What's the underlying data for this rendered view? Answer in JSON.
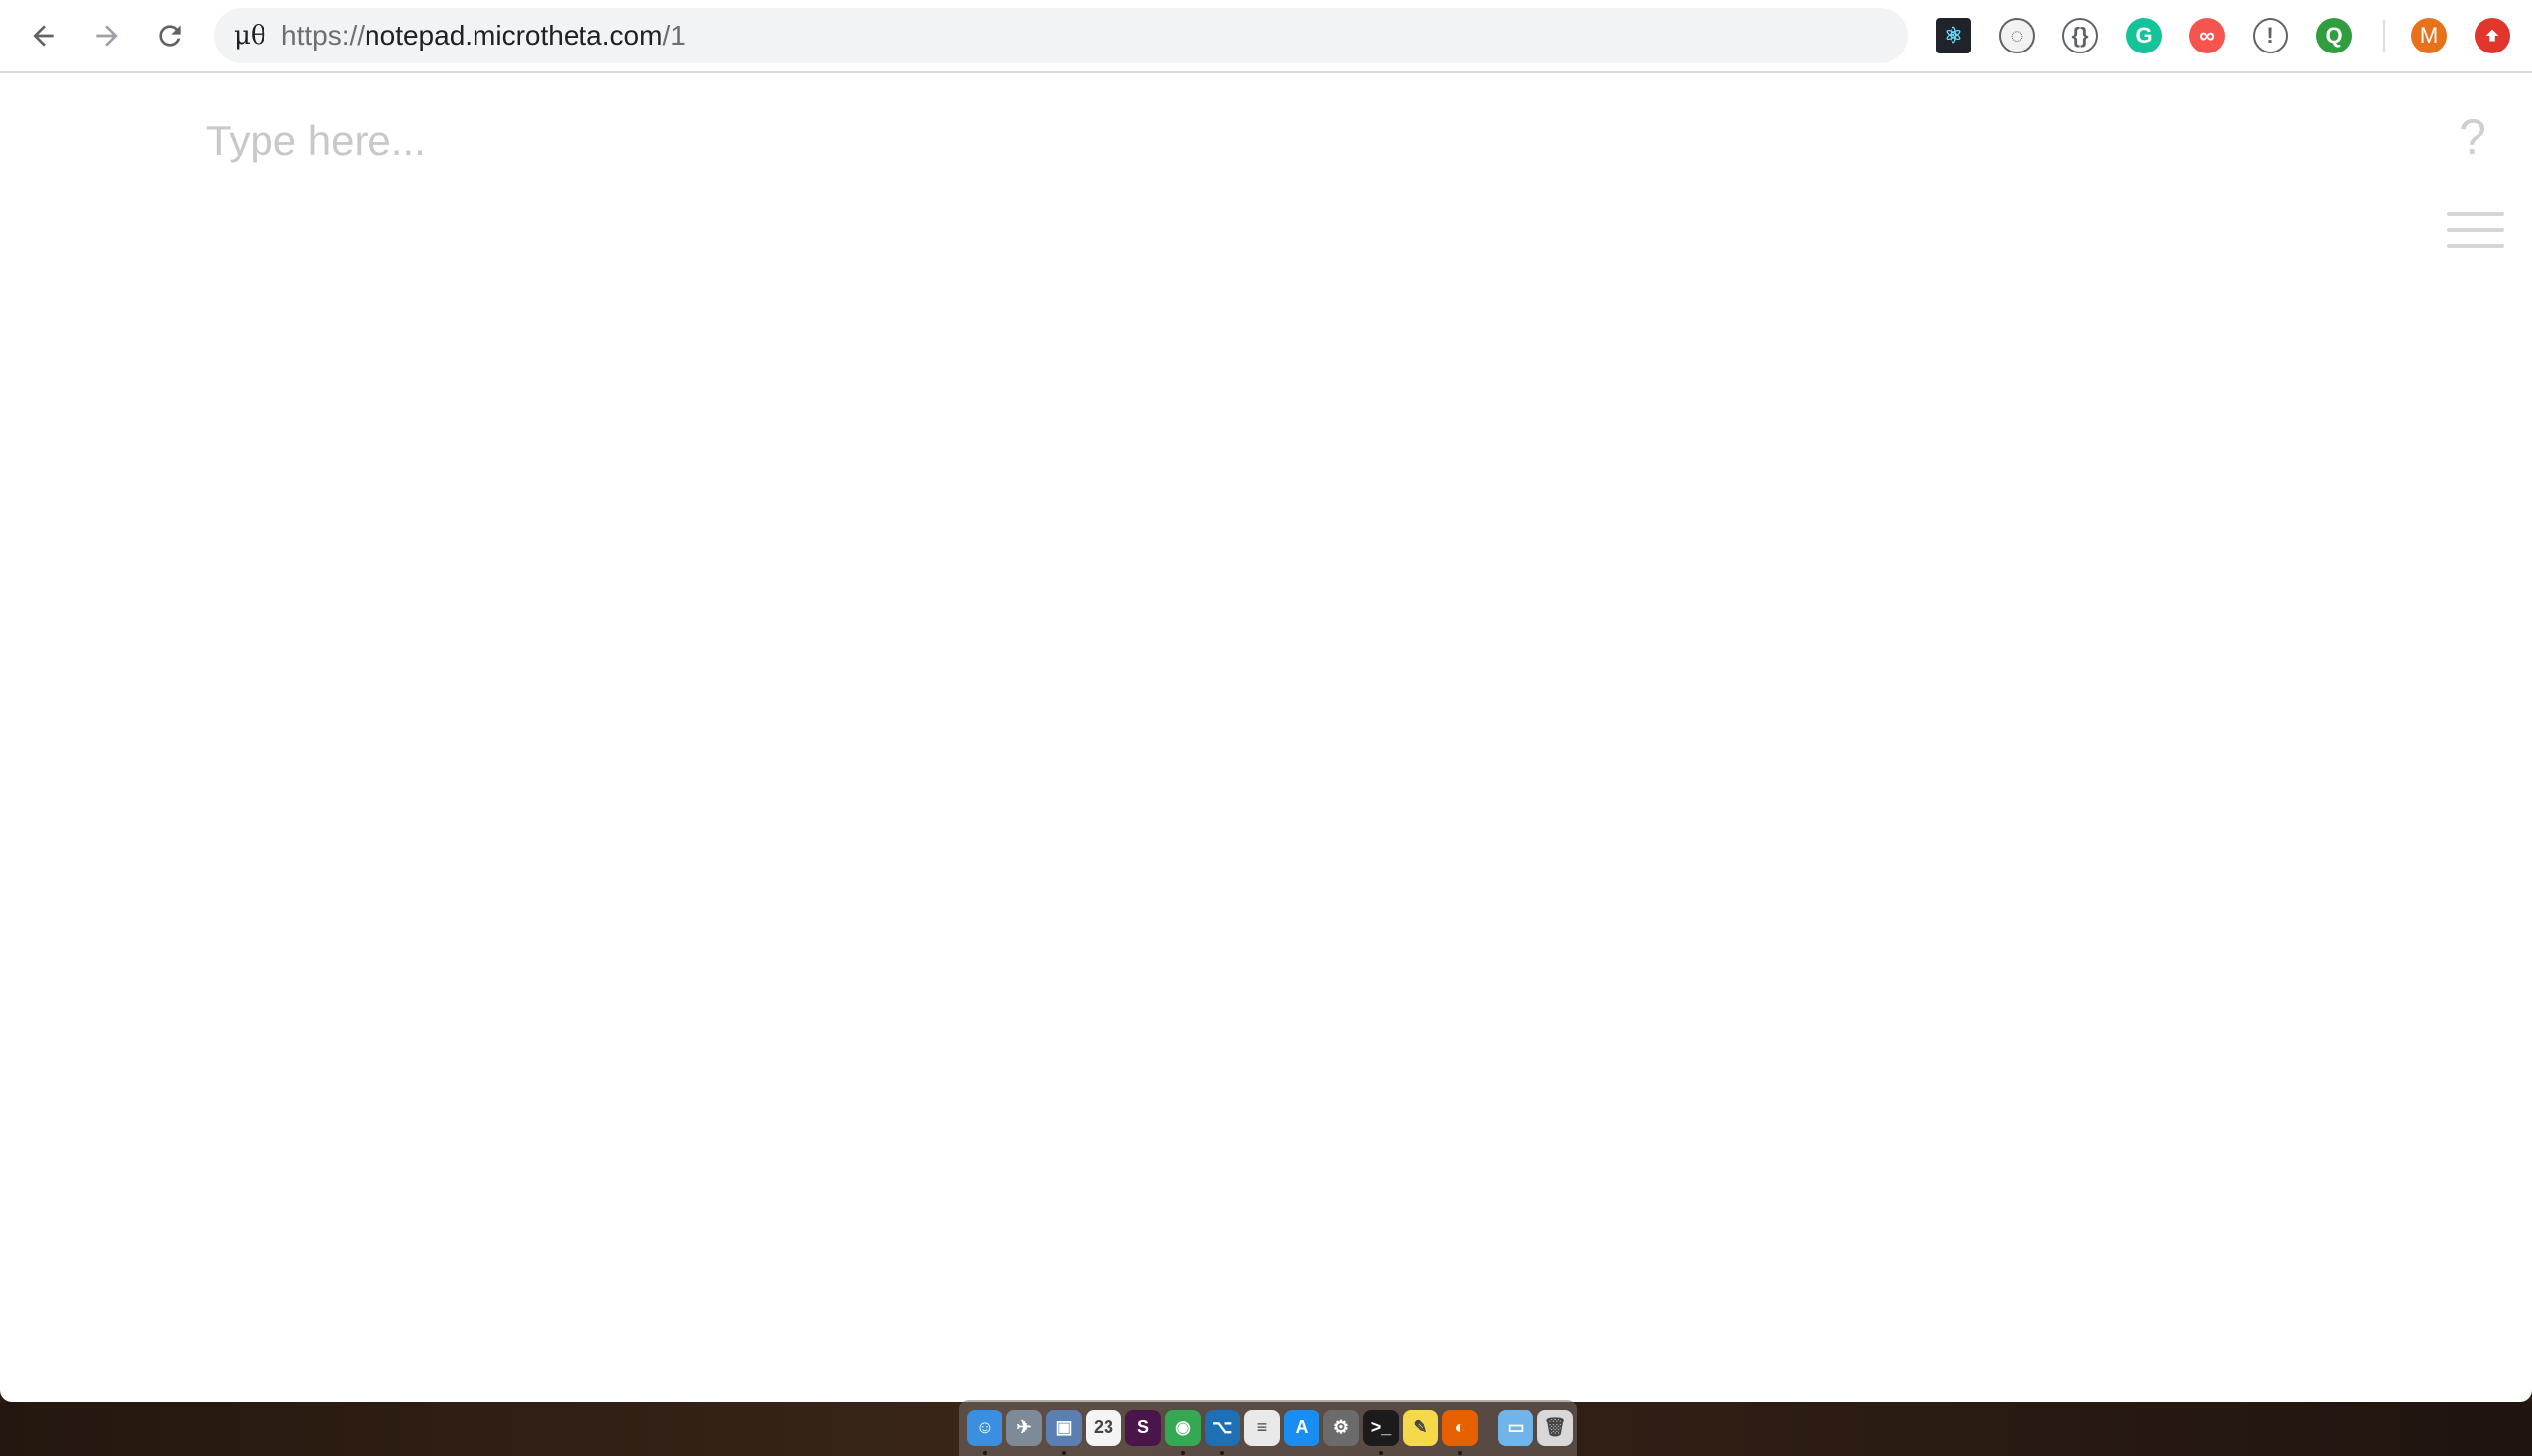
{
  "browser": {
    "site_badge": "μθ",
    "url_scheme": "https://",
    "url_host": "notepad.microtheta.com",
    "url_path": "/1",
    "profile_initial": "M",
    "extensions": [
      {
        "name": "react-devtools-icon",
        "color": "#20232a",
        "glyph": "⚛"
      },
      {
        "name": "tracker-extension-icon",
        "color": "#f2f2f2",
        "glyph": "◌"
      },
      {
        "name": "json-viewer-icon",
        "color": "#ffffff",
        "glyph": "{}"
      },
      {
        "name": "grammarly-icon",
        "color": "#15c39a",
        "glyph": "G"
      },
      {
        "name": "infinity-extension-icon",
        "color": "#f6554f",
        "glyph": "∞"
      },
      {
        "name": "1password-icon",
        "color": "#ffffff",
        "glyph": "!"
      },
      {
        "name": "search-extension-icon",
        "color": "#2e9e3f",
        "glyph": "Q"
      }
    ],
    "profile_color": "#e8711c",
    "update_color": "#e0362b"
  },
  "editor": {
    "placeholder": "Type here...",
    "help_label": "?"
  },
  "dock": {
    "items": [
      {
        "name": "finder-icon",
        "color": "#3b8fe0",
        "glyph": "☺",
        "running": true
      },
      {
        "name": "launchpad-icon",
        "color": "#7d8a97",
        "glyph": "✈",
        "running": false
      },
      {
        "name": "preview-icon",
        "color": "#5a7fb0",
        "glyph": "▣",
        "running": true
      },
      {
        "name": "calendar-icon",
        "color": "#f4f4f4",
        "glyph": "23",
        "running": false
      },
      {
        "name": "slack-icon",
        "color": "#4a154b",
        "glyph": "S",
        "running": false
      },
      {
        "name": "chrome-icon",
        "color": "#34a853",
        "glyph": "◉",
        "running": true
      },
      {
        "name": "vscode-icon",
        "color": "#1f6fb5",
        "glyph": "⌥",
        "running": true
      },
      {
        "name": "textedit-icon",
        "color": "#e9e9e9",
        "glyph": "≡",
        "running": false
      },
      {
        "name": "app-store-icon",
        "color": "#1a8df1",
        "glyph": "A",
        "running": false
      },
      {
        "name": "system-preferences-icon",
        "color": "#6b6b6b",
        "glyph": "⚙",
        "running": false
      },
      {
        "name": "terminal-icon",
        "color": "#1b1b1b",
        "glyph": ">_",
        "running": true
      },
      {
        "name": "stickies-icon",
        "color": "#f5d94a",
        "glyph": "✎",
        "running": false
      },
      {
        "name": "firefox-icon",
        "color": "#e66000",
        "glyph": "◐",
        "running": true
      }
    ],
    "trailing": [
      {
        "name": "downloads-folder-icon",
        "color": "#6fb5ea",
        "glyph": "▭"
      },
      {
        "name": "trash-icon",
        "color": "#d8d8d8",
        "glyph": "🗑"
      }
    ]
  }
}
